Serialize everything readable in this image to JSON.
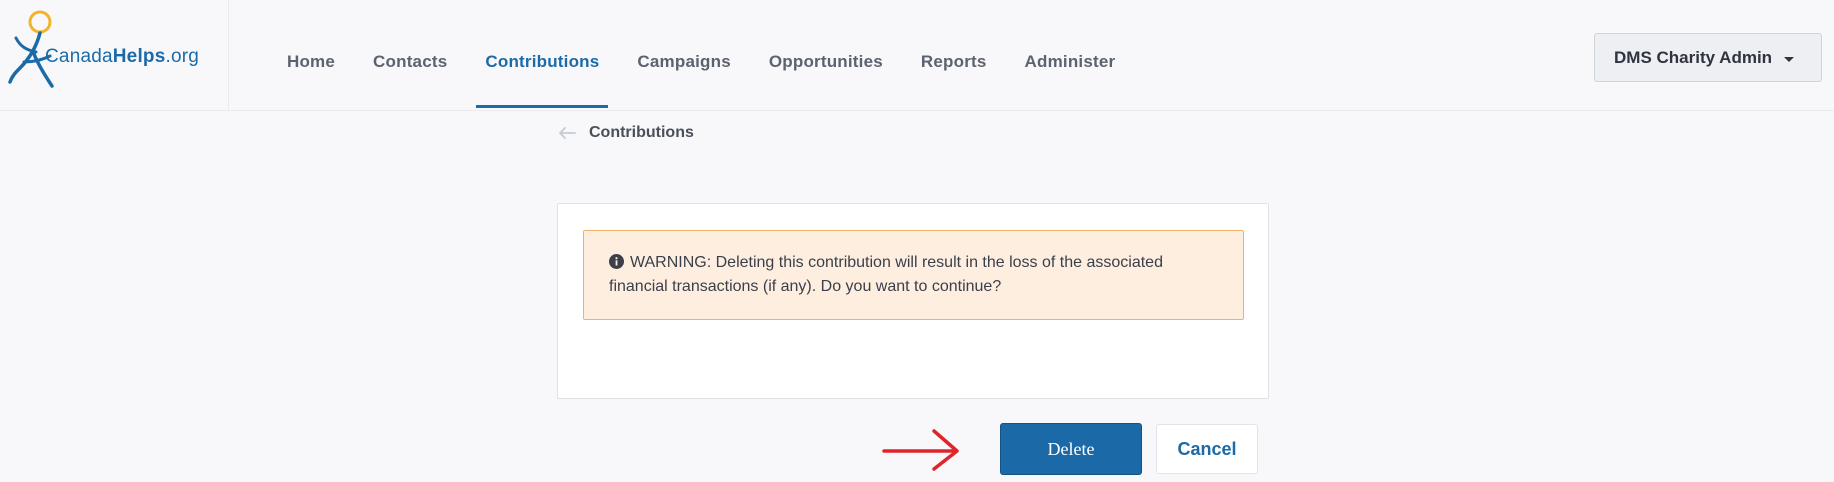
{
  "logo": {
    "text_part1": "Canada",
    "text_part2": "Helps",
    "text_part3": ".org",
    "icon": "canadahelps-figure-icon",
    "colors": {
      "figure_blue": "#1b6ba8",
      "figure_head": "#f2b42a"
    }
  },
  "nav": {
    "items": [
      {
        "label": "Home",
        "active": false
      },
      {
        "label": "Contacts",
        "active": false
      },
      {
        "label": "Contributions",
        "active": true
      },
      {
        "label": "Campaigns",
        "active": false
      },
      {
        "label": "Opportunities",
        "active": false
      },
      {
        "label": "Reports",
        "active": false
      },
      {
        "label": "Administer",
        "active": false
      }
    ]
  },
  "user_menu": {
    "label": "DMS Charity Admin",
    "icon": "caret-down-icon"
  },
  "breadcrumb": {
    "back_icon": "arrow-left-icon",
    "label": "Contributions"
  },
  "warning": {
    "icon": "info-circle-icon",
    "text": "WARNING: Deleting this contribution will result in the loss of the associated financial transactions (if any). Do you want to continue?"
  },
  "actions": {
    "delete_label": "Delete",
    "cancel_label": "Cancel",
    "annotation_icon": "red-arrow-icon"
  },
  "colors": {
    "primary": "#1b6aa7",
    "warning_bg": "#fdeee0",
    "warning_border": "#f0b26a",
    "annotation": "#e0242b"
  }
}
